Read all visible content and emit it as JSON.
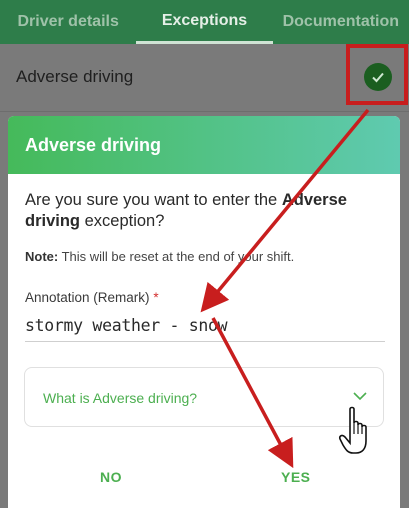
{
  "tabs": [
    {
      "label": "Driver details"
    },
    {
      "label": "Exceptions"
    },
    {
      "label": "Documentation"
    }
  ],
  "row": {
    "label": "Adverse driving",
    "status_icon": "check-icon"
  },
  "dialog": {
    "title": "Adverse driving",
    "question_prefix": "Are you sure you want to enter the ",
    "question_bold": "Adverse",
    "question_line2_bold": "driving",
    "question_suffix": " exception?",
    "note_label": "Note:",
    "note_text": " This will be reset at the end of your shift.",
    "field_label": "Annotation (Remark)",
    "field_required": "*",
    "field_value": "stormy weather - snow",
    "accordion_label": "What is Adverse driving?",
    "no_label": "NO",
    "yes_label": "YES"
  },
  "colors": {
    "accent": "#4caf50",
    "annotation_red": "#c81e1e",
    "header_start": "#45ba5a",
    "header_end": "#5fcab0"
  }
}
